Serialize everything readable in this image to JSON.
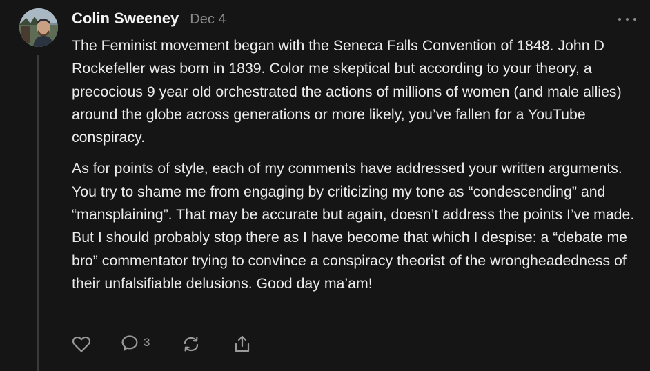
{
  "comment": {
    "author": "Colin Sweeney",
    "date": "Dec 4",
    "paragraphs": [
      "The Feminist movement began with the Seneca Falls Convention of 1848. John D Rockefeller was born in 1839. Color me skeptical but according to your theory, a precocious 9 year old orchestrated the actions of millions of women (and male allies) around the globe across generations or more likely, you’ve fallen for a YouTube conspiracy.",
      "As for points of style, each of my comments have addressed your written arguments. You try to shame me from engaging by criticizing my tone as “condescending” and “mansplaining”. That may be accurate but again, doesn’t address the points I’ve made. But I should probably stop there as I have become that which I despise: a “debate me bro” commentator trying to convince a conspiracy theorist of the wrongheadedness of their unfalsifiable delusions. Good day ma’am!"
    ],
    "actions": {
      "like": {
        "icon": "heart-icon"
      },
      "reply": {
        "icon": "comment-icon",
        "count": "3"
      },
      "restack": {
        "icon": "restack-icon"
      },
      "share": {
        "icon": "share-icon"
      }
    },
    "more_icon": "ellipsis-icon"
  },
  "colors": {
    "background": "#151515",
    "text": "#ececec",
    "muted": "#8b8b8b",
    "thread_line": "#3a3a3a"
  }
}
